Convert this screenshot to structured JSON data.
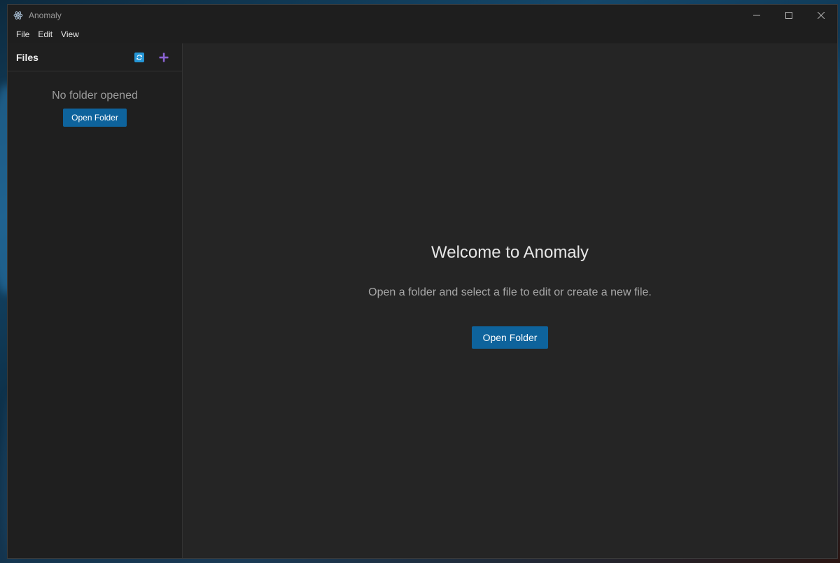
{
  "window": {
    "title": "Anomaly",
    "app_icon": "electron-icon"
  },
  "menu": {
    "items": [
      "File",
      "Edit",
      "View"
    ]
  },
  "sidebar": {
    "title": "Files",
    "refresh_icon": "refresh-icon",
    "add_icon": "plus-icon",
    "empty_message": "No folder opened",
    "open_folder_label": "Open Folder"
  },
  "main": {
    "welcome_title": "Welcome to Anomaly",
    "welcome_subtitle": "Open a folder and select a file to edit or create a new file.",
    "open_folder_label": "Open Folder"
  },
  "colors": {
    "accent_button": "#0e639c",
    "refresh_icon": "#2596d6",
    "plus_icon": "#8a63d2",
    "background": "#252525",
    "sidebar": "#1f1f1f"
  }
}
